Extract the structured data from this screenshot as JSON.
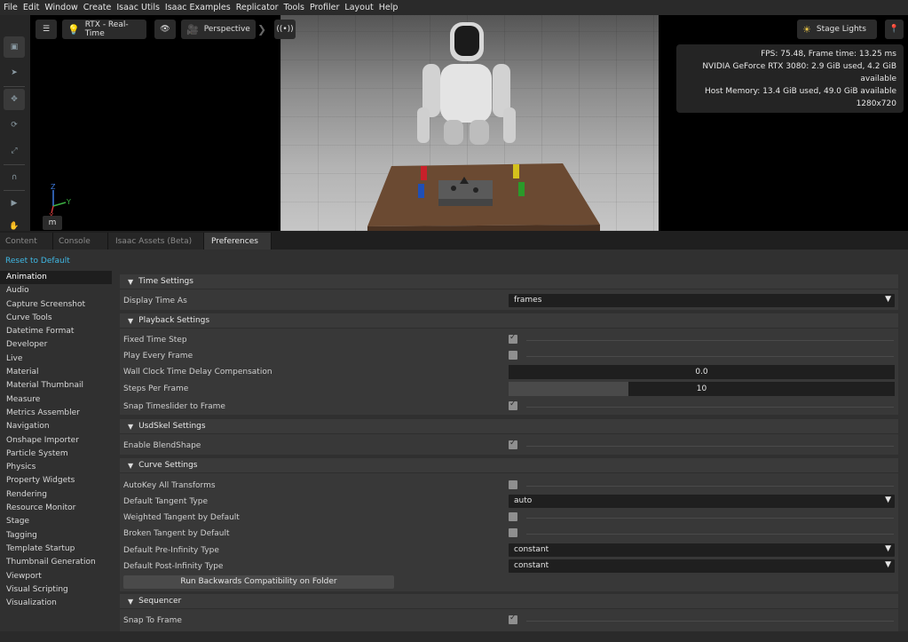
{
  "menu": [
    "File",
    "Edit",
    "Window",
    "Create",
    "Isaac Utils",
    "Isaac Examples",
    "Replicator",
    "Tools",
    "Profiler",
    "Layout",
    "Help"
  ],
  "viewport": {
    "render_mode": "RTX - Real-Time",
    "camera": "Perspective",
    "stage_lights": "Stage Lights",
    "axis_z": "Z",
    "axis_y": "Y",
    "axis_x": "X",
    "units": "m",
    "stats": {
      "fps": "FPS: 75.48, Frame time: 13.25 ms",
      "gpu": "NVIDIA GeForce RTX 3080: 2.9 GiB used, 4.2 GiB available",
      "host": "Host Memory: 13.4 GiB used, 49.0 GiB available",
      "resolution": "1280x720"
    }
  },
  "tabs": [
    "Content",
    "Console",
    "Isaac Assets (Beta)",
    "Preferences"
  ],
  "preferences": {
    "reset_label": "Reset to Default",
    "categories": [
      "Animation",
      "Audio",
      "Capture Screenshot",
      "Curve Tools",
      "Datetime Format",
      "Developer",
      "Live",
      "Material",
      "Material Thumbnail",
      "Measure",
      "Metrics Assembler",
      "Navigation",
      "Onshape Importer",
      "Particle System",
      "Physics",
      "Property Widgets",
      "Rendering",
      "Resource Monitor",
      "Stage",
      "Tagging",
      "Template Startup",
      "Thumbnail Generation",
      "Viewport",
      "Visual Scripting",
      "Visualization"
    ],
    "time_settings": {
      "title": "Time Settings",
      "display_time_as_label": "Display Time As",
      "display_time_as_value": "frames"
    },
    "playback_settings": {
      "title": "Playback Settings",
      "fixed_time_step_label": "Fixed Time Step",
      "play_every_frame_label": "Play Every Frame",
      "wall_clock_label": "Wall Clock Time Delay Compensation",
      "wall_clock_value": "0.0",
      "steps_per_frame_label": "Steps Per Frame",
      "steps_per_frame_value": "10",
      "steps_per_frame_fraction": 0.31,
      "snap_timeslider_label": "Snap Timeslider to Frame"
    },
    "usdskel_settings": {
      "title": "UsdSkel Settings",
      "enable_blendshape_label": "Enable BlendShape"
    },
    "curve_settings": {
      "title": "Curve Settings",
      "autokey_label": "AutoKey All Transforms",
      "default_tangent_label": "Default Tangent Type",
      "default_tangent_value": "auto",
      "weighted_tangent_label": "Weighted Tangent by Default",
      "broken_tangent_label": "Broken Tangent by Default",
      "pre_infinity_label": "Default Pre-Infinity Type",
      "pre_infinity_value": "constant",
      "post_infinity_label": "Default Post-Infinity Type",
      "post_infinity_value": "constant",
      "run_compat_label": "Run Backwards Compatibility on Folder"
    },
    "sequencer": {
      "title": "Sequencer",
      "snap_to_frame_label": "Snap To Frame"
    }
  }
}
